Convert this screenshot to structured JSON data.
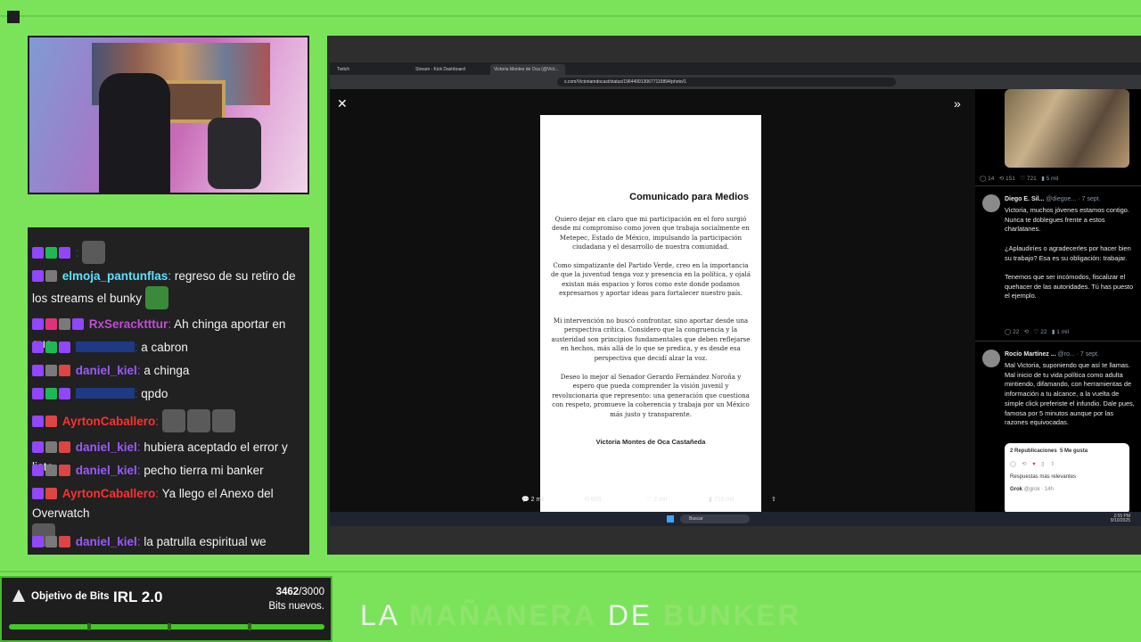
{
  "chat": {
    "messages": [
      {
        "user": "",
        "text": "",
        "color": "#1d4fd8"
      },
      {
        "user": "elmoja_pantunflas",
        "text": "regreso de su retiro de los streams el bunky",
        "color": "#5ee0ff"
      },
      {
        "user": "RxSeracktttur",
        "text": "Ah chinga aportar en que",
        "color": "#c34bd6"
      },
      {
        "user": "",
        "text": "a cabron",
        "color": "#1d4fd8"
      },
      {
        "user": "daniel_kiel",
        "text": "a chinga",
        "color": "#9b59ff"
      },
      {
        "user": "",
        "text": "qpdo",
        "color": "#1d4fd8"
      },
      {
        "user": "AyrtonCaballero",
        "text": "",
        "color": "#ff3030"
      },
      {
        "user": "daniel_kiel",
        "text": "hubiera aceptado el error y listo",
        "color": "#9b59ff"
      },
      {
        "user": "daniel_kiel",
        "text": "pecho tierra mi banker",
        "color": "#9b59ff"
      },
      {
        "user": "AyrtonCaballero",
        "text": "Ya llego el Anexo del Overwatch",
        "color": "#ff3030"
      },
      {
        "user": "daniel_kiel",
        "text": "la patrulla espiritual we",
        "color": "#9b59ff"
      }
    ]
  },
  "goal": {
    "label": "Objetivo de Bits",
    "title": "IRL 2.0",
    "current": "3462",
    "target": "/3000",
    "subtitle": "Bits nuevos."
  },
  "stream_title": {
    "la": "LA ",
    "mananera": "MAÑANERA",
    "de": " DE ",
    "bunker": "BUNKER"
  },
  "browser": {
    "tabs": [
      "Twitch",
      "Stream - Kick Dashboard",
      "Victoria Montes de Oca (@Vict..."
    ],
    "url": "x.com/Victoriamdocast/status/1964499130677115894/photo/1"
  },
  "document": {
    "title": "Comunicado para Medios",
    "paragraphs": [
      "Quiero dejar en claro que mi participación en el foro surgió desde mi compromiso como joven que trabaja socialmente en Metepec, Estado de México, impulsando la participación ciudadana y el desarrollo de nuestra comunidad.",
      "Como simpatizante del Partido Verde, creo en la importancia de que la juventud tenga voz y presencia en la política, y ojalá existan más espacios y foros como este donde podamos expresarnos y aportar ideas para fortalecer nuestro país.",
      "Mi intervención no buscó confrontar, sino aportar desde una perspectiva crítica. Considero que la congruencia y la austeridad son principios fundamentales que deben reflejarse en hechos, más allá de lo que se predica, y es desde esa perspectiva que decidí alzar la voz.",
      "Deseo lo mejor al Senador Gerardo Fernández Noroña y espero que pueda comprender la visión juvenil y revolucionaria que represento: una generación que cuestiona con respeto, promueve la coherencia y trabaja por un México más justo y transparente."
    ],
    "signature": "Victoria Montes de Oca Castañeda"
  },
  "post_actions": {
    "replies": "2 mil",
    "reposts": "805",
    "likes": "2 mil",
    "views": "716 mil"
  },
  "taskbar": {
    "search": "Buscar",
    "time": "2:55 PM",
    "date": "9/10/2025"
  },
  "feed": {
    "top_stats": {
      "replies": "14",
      "reposts": "151",
      "likes": "721",
      "views": "5 mil"
    },
    "replies": [
      {
        "name": "Diego E. Sil...",
        "handle": "@diegoe...",
        "date": "· 7 sept.",
        "text": "Victoria, muchos jóvenes estamos contigo. Nunca te doblegues frente a estos charlatanes.\n\n¿Aplaudiríes o agradecerles por hacer bien su trabajo? Esa es su obligación: trabajar.\n\nTenemos que ser incómodos, fiscalizar el quehacer de las autoridades. Tú has puesto el ejemplo.",
        "stats": {
          "replies": "22",
          "likes": "22",
          "views": "1 mil"
        }
      },
      {
        "name": "Rocío Martínez ...",
        "handle": "@ro...",
        "date": "· 7 sept.",
        "text": "Mal Victoria, suponiendo que así te llamas. Mal inicio de tu vida política como adulta mintiendo, difamando, con herramientas de información a tu alcance, a la vuelta de simple click preferiste el infundio. Dale pues, famosa por 5 minutos aunque por las razones equivocadas."
      }
    ],
    "card": {
      "reposts": "2 Republicaciones",
      "likes": "5 Me gusta",
      "sort": "Respuestas más relevantes",
      "grok": "Grok",
      "grok_handle": "@grok · 14h"
    }
  }
}
